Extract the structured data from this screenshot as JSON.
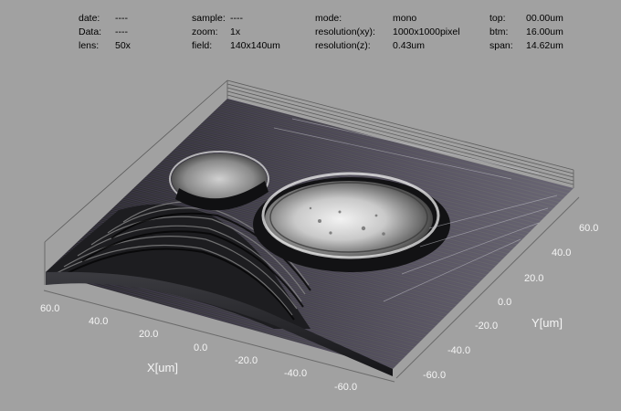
{
  "info": {
    "col1": [
      {
        "label": "date:",
        "value": "----"
      },
      {
        "label": "Data:",
        "value": "----"
      },
      {
        "label": "lens:",
        "value": "50x"
      }
    ],
    "col2": [
      {
        "label": "sample:",
        "value": "----"
      },
      {
        "label": "zoom:",
        "value": "1x"
      },
      {
        "label": "field:",
        "value": "140x140um"
      }
    ],
    "col3": [
      {
        "label": "mode:",
        "value": "mono"
      },
      {
        "label": "resolution(xy):",
        "value": "1000x1000pixel"
      },
      {
        "label": "resolution(z):",
        "value": "0.43um"
      }
    ],
    "col4": [
      {
        "label": "top:",
        "value": "00.00um"
      },
      {
        "label": "btm:",
        "value": "16.00um"
      },
      {
        "label": "span:",
        "value": "14.62um"
      }
    ]
  },
  "axes": {
    "x_title": "X[um]",
    "y_title": "Y[um]",
    "x_ticks": [
      "60.0",
      "40.0",
      "20.0",
      "0.0",
      "-20.0",
      "-40.0",
      "-60.0"
    ],
    "y_ticks": [
      "-60.0",
      "-40.0",
      "-20.0",
      "0.0",
      "20.0",
      "40.0",
      "60.0"
    ]
  },
  "colors": {
    "background": "#a1a1a1",
    "axis_text": "#f4f4f4",
    "surface_dark": "#1a1a1d",
    "surface_bright": "#d9d9d9",
    "stripe_purple": "#6a5e84"
  }
}
